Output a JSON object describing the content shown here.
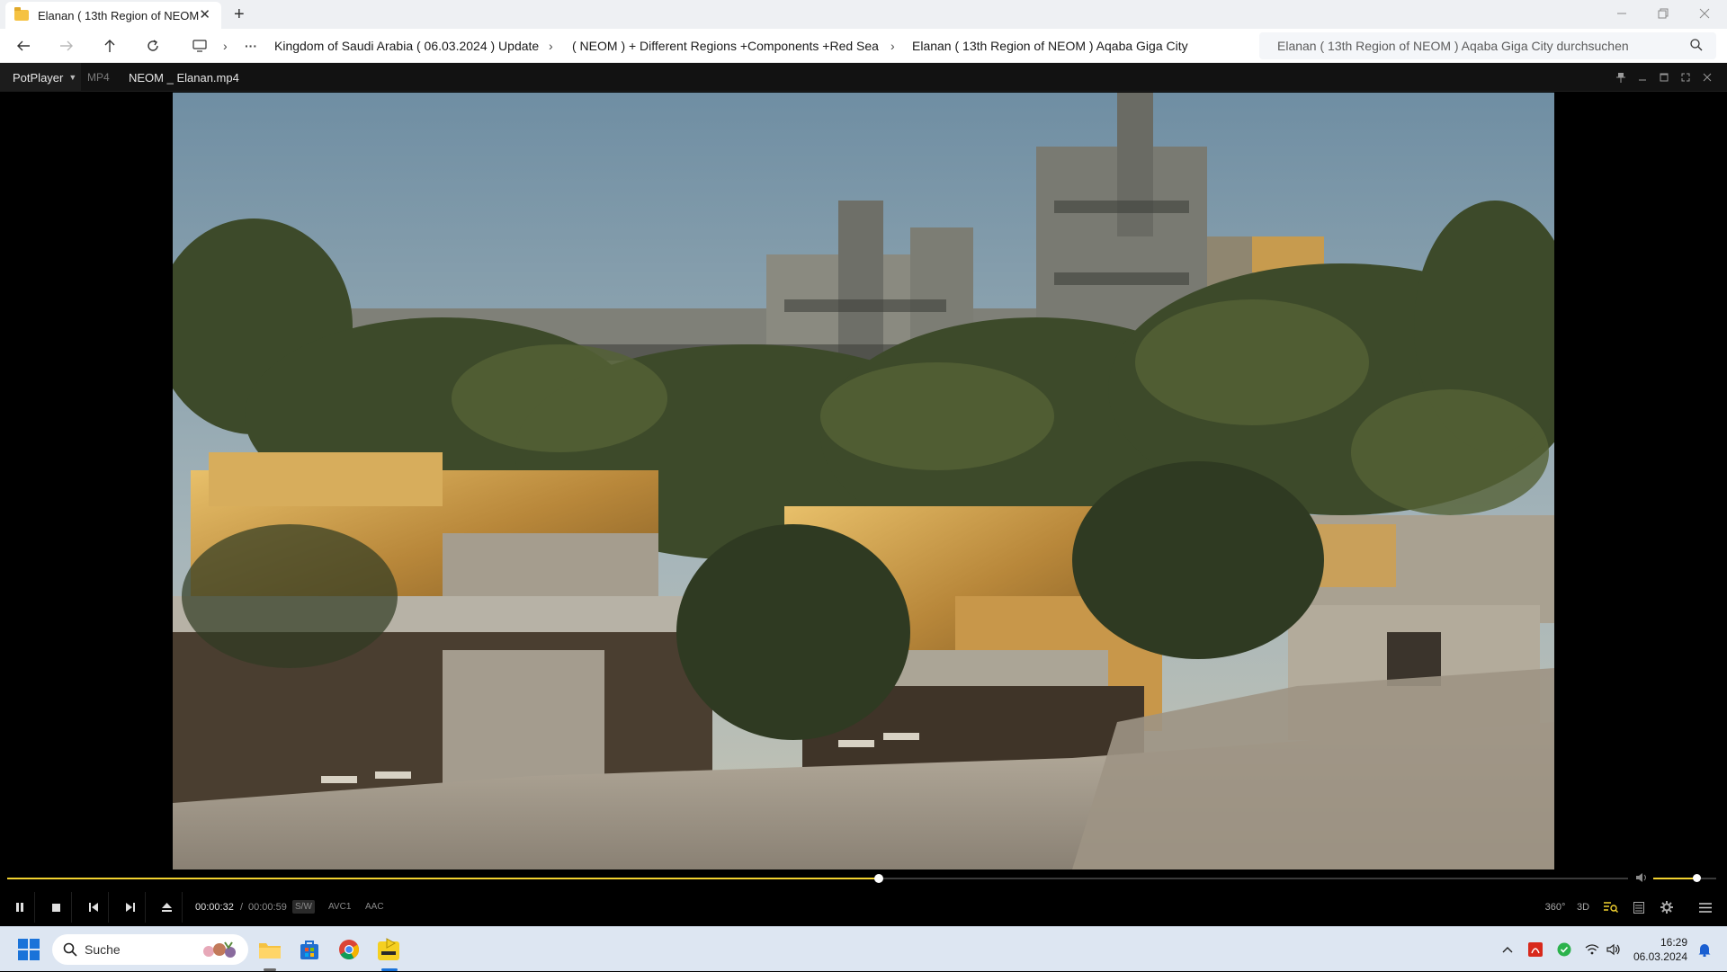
{
  "explorer": {
    "tab_title": "Elanan ( 13th Region of NEOM",
    "tab_close": "✕",
    "new_tab": "+",
    "breadcrumbs": [
      "Kingdom of Saudi Arabia ( 06.03.2024 ) Update",
      "( NEOM ) + Different Regions +Components +Red Sea",
      "Elanan ( 13th Region of NEOM ) Aqaba Giga City"
    ],
    "search_placeholder": "Elanan ( 13th Region of NEOM ) Aqaba Giga City durchsuchen",
    "more": "···"
  },
  "player": {
    "brand": "PotPlayer",
    "format": "MP4",
    "filename": "NEOM _ Elanan.mp4",
    "time_current": "00:00:32",
    "time_separator": "/",
    "time_total": "00:00:59",
    "progress_percent": 53.8,
    "volume_percent": 69,
    "tags": [
      "S/W",
      "AVC1",
      "AAC"
    ],
    "right_buttons": [
      "360°",
      "3D"
    ]
  },
  "taskbar": {
    "search_label": "Suche",
    "clock_time": "16:29",
    "clock_date": "06.03.2024"
  },
  "colors": {
    "accent_yellow": "#f2d230",
    "player_bg": "#121212",
    "taskbar_bg": "#dde6f2"
  }
}
